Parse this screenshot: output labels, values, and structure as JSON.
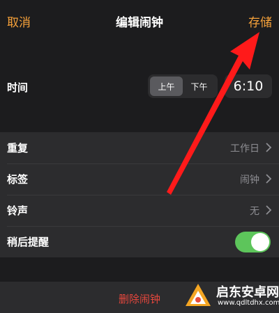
{
  "navbar": {
    "cancel_label": "取消",
    "title": "编辑闹钟",
    "save_label": "存储"
  },
  "time": {
    "label": "时间",
    "am_label": "上午",
    "pm_label": "下午",
    "selected": "am",
    "value": "6:10"
  },
  "settings": [
    {
      "label": "重复",
      "value": "工作日"
    },
    {
      "label": "标签",
      "value": "闹钟"
    },
    {
      "label": "铃声",
      "value": "无"
    }
  ],
  "snooze": {
    "label": "稍后提醒",
    "on": true
  },
  "delete_label": "删除闹钟",
  "watermark": {
    "title": "启东安卓网",
    "url": "www.qdltdhx.com"
  },
  "colors": {
    "accent": "#f7a23a",
    "destructive": "#e5473d",
    "toggle_on": "#5dc55b",
    "annotation_arrow": "#ff1a1a"
  }
}
